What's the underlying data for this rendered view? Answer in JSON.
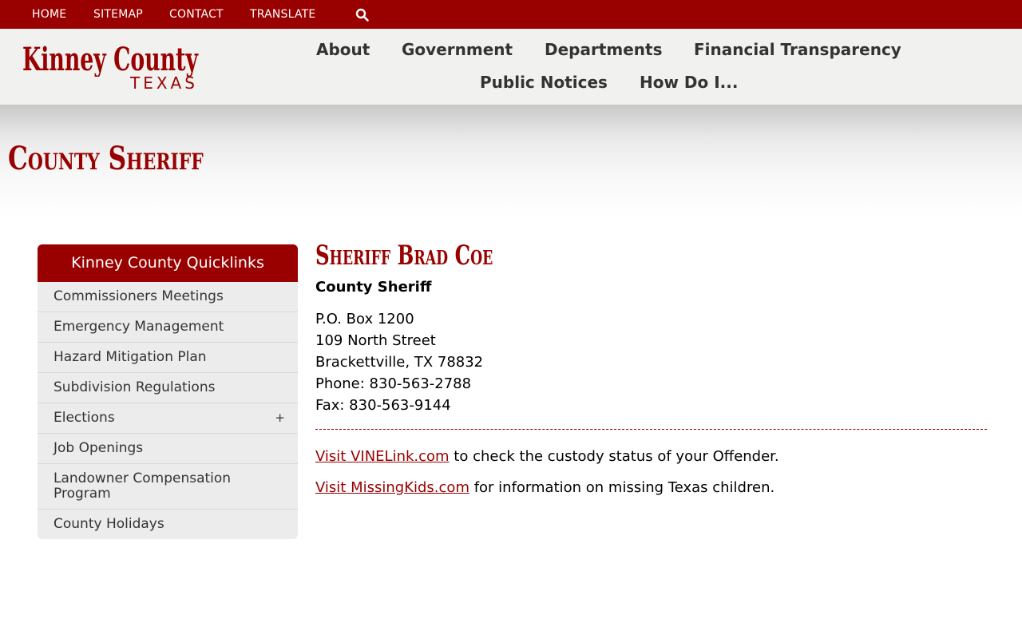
{
  "topbar": {
    "links": [
      "HOME",
      "SITEMAP",
      "CONTACT",
      "TRANSLATE"
    ],
    "search_icon": "search-icon"
  },
  "header": {
    "logo_line1": "Kinney County",
    "logo_line2": "TEXAS",
    "nav": [
      "About",
      "Government",
      "Departments",
      "Financial Transparency",
      "Public Notices",
      "How Do I..."
    ]
  },
  "page": {
    "title": "County Sheriff"
  },
  "sidebar": {
    "heading": "Kinney County Quicklinks",
    "items": [
      {
        "label": "Commissioners Meetings"
      },
      {
        "label": "Emergency Management"
      },
      {
        "label": "Hazard Mitigation Plan"
      },
      {
        "label": "Subdivision Regulations"
      },
      {
        "label": "Elections",
        "expand": "+"
      },
      {
        "label": "Job Openings"
      },
      {
        "label": "Landowner Compensation Program"
      },
      {
        "label": "County Holidays"
      }
    ]
  },
  "content": {
    "name": "Sheriff Brad Coe",
    "role": "County Sheriff",
    "address": [
      "P.O. Box 1200",
      "109 North Street",
      "Brackettville, TX 78832",
      "Phone: 830-563-2788",
      "Fax: 830-563-9144"
    ],
    "links": [
      {
        "link_text": "Visit VINELink.com",
        "rest": " to check the custody status of your Offender."
      },
      {
        "link_text": "Visit MissingKids.com",
        "rest": " for information on missing Texas children."
      }
    ]
  },
  "colors": {
    "brand": "#990000",
    "header_bg": "#f1f1ef",
    "sidebar_bg": "#ececec"
  }
}
